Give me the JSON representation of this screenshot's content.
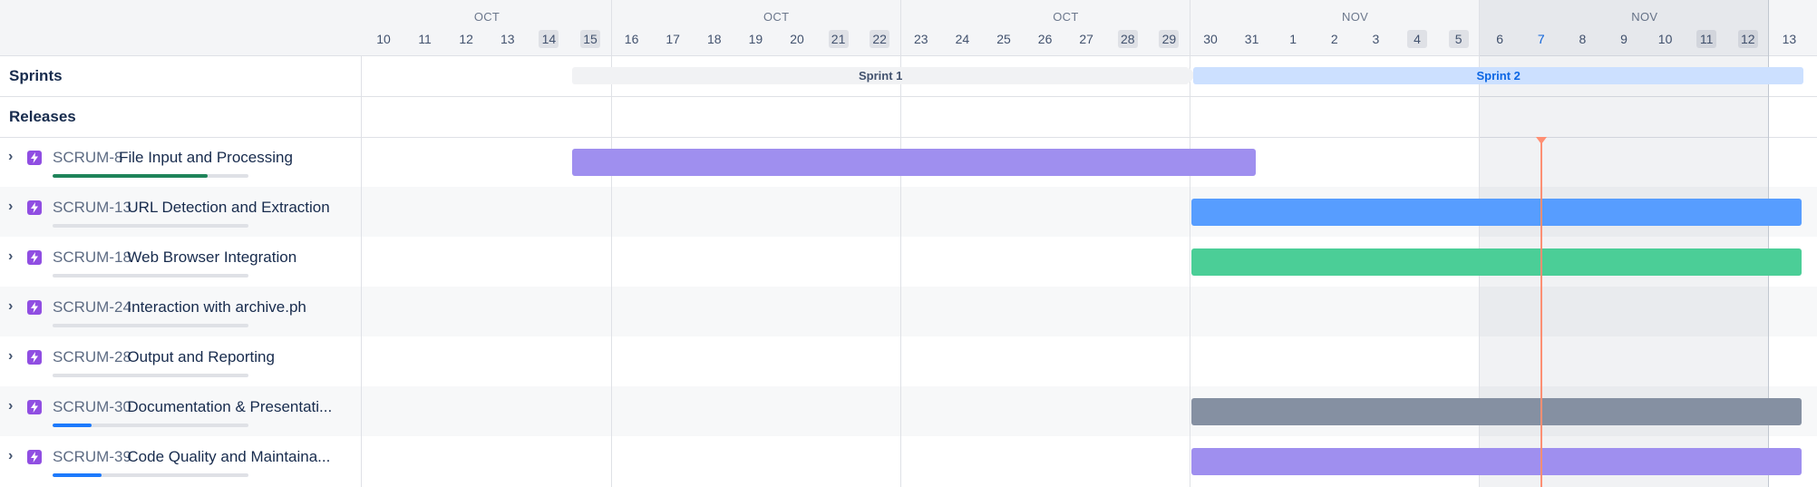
{
  "timeline": {
    "months": [
      {
        "label": "OCT"
      },
      {
        "label": "OCT"
      },
      {
        "label": "OCT"
      },
      {
        "label": "NOV"
      },
      {
        "label": "NOV"
      }
    ],
    "days": [
      {
        "label": "10",
        "weekend": false
      },
      {
        "label": "11",
        "weekend": false
      },
      {
        "label": "12",
        "weekend": false
      },
      {
        "label": "13",
        "weekend": false
      },
      {
        "label": "14",
        "weekend": true
      },
      {
        "label": "15",
        "weekend": true
      },
      {
        "label": "16",
        "weekend": false
      },
      {
        "label": "17",
        "weekend": false
      },
      {
        "label": "18",
        "weekend": false
      },
      {
        "label": "19",
        "weekend": false
      },
      {
        "label": "20",
        "weekend": false
      },
      {
        "label": "21",
        "weekend": true
      },
      {
        "label": "22",
        "weekend": true
      },
      {
        "label": "23",
        "weekend": false
      },
      {
        "label": "24",
        "weekend": false
      },
      {
        "label": "25",
        "weekend": false
      },
      {
        "label": "26",
        "weekend": false
      },
      {
        "label": "27",
        "weekend": false
      },
      {
        "label": "28",
        "weekend": true
      },
      {
        "label": "29",
        "weekend": true
      },
      {
        "label": "30",
        "weekend": false
      },
      {
        "label": "31",
        "weekend": false
      },
      {
        "label": "1",
        "weekend": false
      },
      {
        "label": "2",
        "weekend": false
      },
      {
        "label": "3",
        "weekend": false
      },
      {
        "label": "4",
        "weekend": true
      },
      {
        "label": "5",
        "weekend": true
      },
      {
        "label": "6",
        "weekend": false
      },
      {
        "label": "7",
        "weekend": false,
        "today": true
      },
      {
        "label": "8",
        "weekend": false
      },
      {
        "label": "9",
        "weekend": false
      },
      {
        "label": "10",
        "weekend": false
      },
      {
        "label": "11",
        "weekend": true
      },
      {
        "label": "12",
        "weekend": true
      },
      {
        "label": "13",
        "weekend": false
      }
    ]
  },
  "sections": {
    "sprints_label": "Sprints",
    "releases_label": "Releases"
  },
  "sprints": [
    {
      "name": "Sprint 1",
      "start_day": "15",
      "end_day": "29 Oct",
      "status": "closed"
    },
    {
      "name": "Sprint 2",
      "start_day": "30 Oct",
      "end_day": "13 Nov",
      "status": "active"
    }
  ],
  "epics": [
    {
      "key": "SCRUM-8",
      "title": "File Input and Processing",
      "progress": 0.79,
      "progress_color": "#1f845a",
      "bar_color": "#9f8fef",
      "bar_start": "15 Oct",
      "bar_end": "30 Oct"
    },
    {
      "key": "SCRUM-13",
      "title": "URL Detection and Extraction",
      "progress": 0,
      "progress_color": "#1d7afc",
      "bar_color": "#579dff",
      "bar_start": "30 Oct",
      "bar_end": "13 Nov"
    },
    {
      "key": "SCRUM-18",
      "title": "Web Browser Integration",
      "progress": 0,
      "progress_color": "#1d7afc",
      "bar_color": "#4bce97",
      "bar_start": "30 Oct",
      "bar_end": "13 Nov"
    },
    {
      "key": "SCRUM-24",
      "title": "Interaction with archive.ph",
      "progress": 0,
      "progress_color": "#1d7afc",
      "bar_color": null,
      "bar_start": null,
      "bar_end": null
    },
    {
      "key": "SCRUM-28",
      "title": "Output and Reporting",
      "progress": 0,
      "progress_color": "#1d7afc",
      "bar_color": null,
      "bar_start": null,
      "bar_end": null
    },
    {
      "key": "SCRUM-30",
      "title": "Documentation & Presentati...",
      "progress": 0.2,
      "progress_color": "#1d7afc",
      "bar_color": "#8590a2",
      "bar_start": "30 Oct",
      "bar_end": "13 Nov"
    },
    {
      "key": "SCRUM-39",
      "title": "Code Quality and Maintaina...",
      "progress": 0.25,
      "progress_color": "#1d7afc",
      "bar_color": "#9f8fef",
      "bar_start": "30 Oct",
      "bar_end": "13 Nov"
    }
  ],
  "today": "7 Nov",
  "colors": {
    "today_line": "#ff8f73",
    "epic_icon": "#904ee2",
    "sprint_active": "#cce0ff",
    "sprint_closed": "#f1f2f4"
  }
}
